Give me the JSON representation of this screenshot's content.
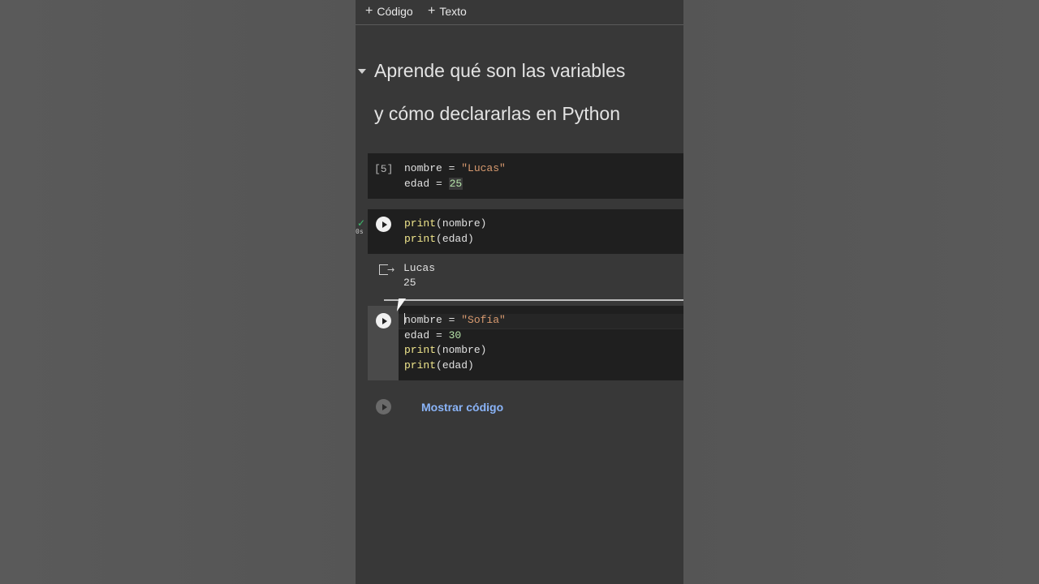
{
  "toolbar": {
    "code_button": "Código",
    "text_button": "Texto"
  },
  "section": {
    "heading_line1": "Aprende qué son las variables",
    "heading_line2": "y cómo declararlas en Python"
  },
  "cell1": {
    "exec_count": "[5]",
    "line1_var": "nombre = ",
    "line1_str": "\"Lucas\"",
    "line2_var": "edad = ",
    "line2_num": "25"
  },
  "cell2": {
    "status_check": "✓",
    "status_time": "0s",
    "line1_fn": "print",
    "line1_arg": "(nombre)",
    "line2_fn": "print",
    "line2_arg": "(edad)"
  },
  "output2": {
    "line1": "Lucas",
    "line2": "25"
  },
  "cell3": {
    "line1_var": "nombre = ",
    "line1_str": "\"Sofía\"",
    "line2_var": "edad = ",
    "line2_num": "30",
    "line3_fn": "print",
    "line3_arg": "(nombre)",
    "line4_fn": "print",
    "line4_arg": "(edad)"
  },
  "hidden_cell": {
    "show_code_label": "Mostrar código"
  },
  "colors": {
    "accent_link": "#8ab4f8",
    "run_ok": "#3fbf6f"
  }
}
